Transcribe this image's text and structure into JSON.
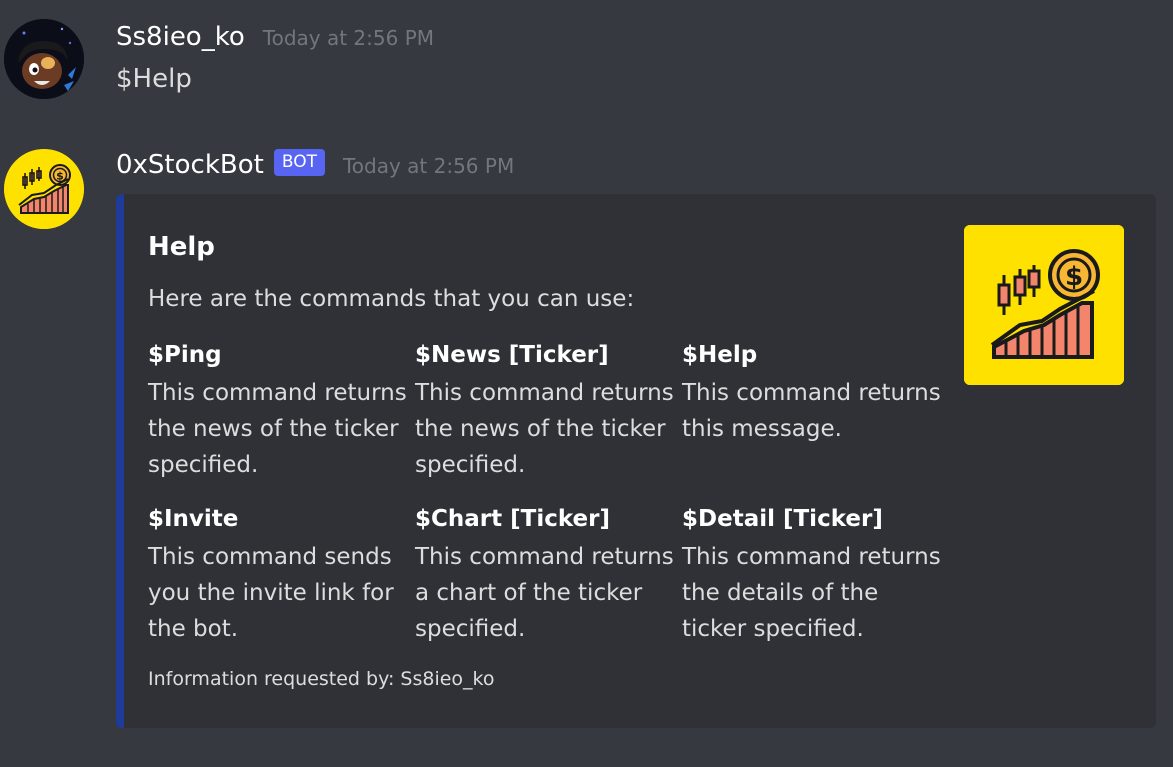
{
  "messages": [
    {
      "username": "Ss8ieo_ko",
      "timestamp": "Today at 2:56 PM",
      "content": "$Help"
    },
    {
      "username": "0xStockBot",
      "bot_tag": "BOT",
      "timestamp": "Today at 2:56 PM",
      "embed": {
        "title": "Help",
        "description": "Here are the commands that you can use:",
        "fields": [
          {
            "name": "$Ping",
            "value": "This command returns the news of the ticker specified."
          },
          {
            "name": "$News [Ticker]",
            "value": "This command returns the news of the ticker specified."
          },
          {
            "name": "$Help",
            "value": "This command returns this message."
          },
          {
            "name": "$Invite",
            "value": "This command sends you the invite link for the bot."
          },
          {
            "name": "$Chart [Ticker]",
            "value": "This command returns a chart of the ticker specified."
          },
          {
            "name": "$Detail [Ticker]",
            "value": "This command returns the details of the ticker specified."
          }
        ],
        "footer": "Information requested by: Ss8ieo_ko",
        "accent_color": "#1f3b99"
      }
    }
  ],
  "colors": {
    "background": "#36393f",
    "embed_background": "#2f3136",
    "bot_tag": "#5865f2",
    "thumbnail_background": "#ffe100"
  },
  "icons": {
    "user_avatar": "cartoon-character-avatar-icon",
    "bot_avatar": "stock-chart-coin-icon",
    "thumbnail": "stock-chart-coin-icon"
  }
}
